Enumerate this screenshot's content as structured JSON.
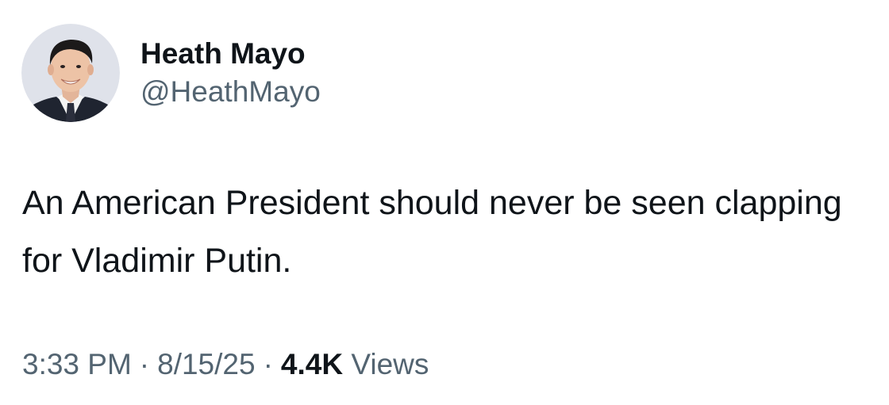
{
  "author": {
    "display_name": "Heath Mayo",
    "handle": "@HeathMayo",
    "avatar_icon": "profile-photo"
  },
  "tweet": {
    "text": "An American President should never be seen clapping for Vladimir Putin."
  },
  "meta": {
    "time": "3:33 PM",
    "separator": "·",
    "date": "8/15/25",
    "views_count": "4.4K",
    "views_label": "Views"
  },
  "colors": {
    "text_primary": "#0f1419",
    "text_secondary": "#536471",
    "background": "#ffffff"
  }
}
